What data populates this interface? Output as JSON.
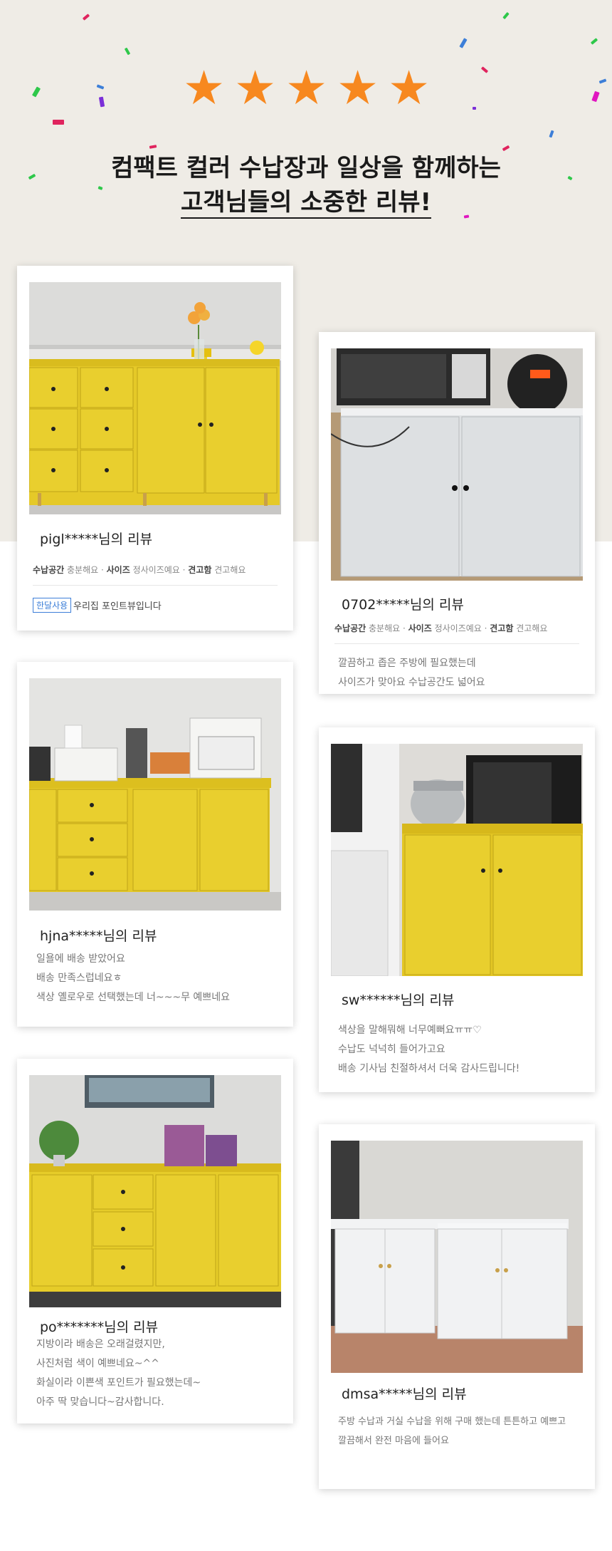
{
  "colors": {
    "top_background": "#efece6",
    "star": "#f7881f",
    "cabinet_yellow": "#e9cf25",
    "cabinet_white": "#e8ebec"
  },
  "header": {
    "stars_icon": "star-icon",
    "line1": "컴팩트 컬러 수납장과 일상을 함께하는",
    "line2": "고객님들의 소중한 리뷰!"
  },
  "reviews": [
    {
      "title": "pigl*****님의 리뷰",
      "tags": {
        "k1": "수납공간",
        "v1": "충분해요",
        "k2": "사이즈",
        "v2": "정사이즈예요",
        "k3": "견고함",
        "v3": "견고해요"
      },
      "badge": "한달사용",
      "badge_text": "우리집 포인트뷰입니다"
    },
    {
      "title": "0702*****님의 리뷰",
      "tags": {
        "k1": "수납공간",
        "v1": "충분해요",
        "k2": "사이즈",
        "v2": "정사이즈예요",
        "k3": "견고함",
        "v3": "견고해요"
      },
      "text": "깔끔하고 좁은 주방에 필요했는데\n사이즈가 맞아요 수납공간도 넓어요"
    },
    {
      "title": "hjna*****님의 리뷰",
      "text": "일욜에 배송 받았어요\n배송 만족스럽네요ㅎ\n색상 옐로우로 선택했는데 너~~~무 예쁘네요"
    },
    {
      "title": "sw******님의 리뷰",
      "text": "색상을 말해뭐해 너무예뻐요ㅠㅠ♡\n수납도 넉넉히 들어가고요\n배송 기사님 친절하셔서 더욱 감사드립니다!"
    },
    {
      "title": "po*******님의 리뷰",
      "text": "지방이라 배송은 오래걸렸지만,\n사진처럼 색이 예쁘네요~^^\n화실이라 이쁜색 포인트가 필요했는데~\n아주 딱 맞습니다~감사합니다."
    },
    {
      "title": "dmsa*****님의 리뷰",
      "text": "주방 수납과 거실 수납을 위해 구매 했는데 튼튼하고 예쁘고\n깔끔해서 완전 마음에 들어요"
    }
  ]
}
